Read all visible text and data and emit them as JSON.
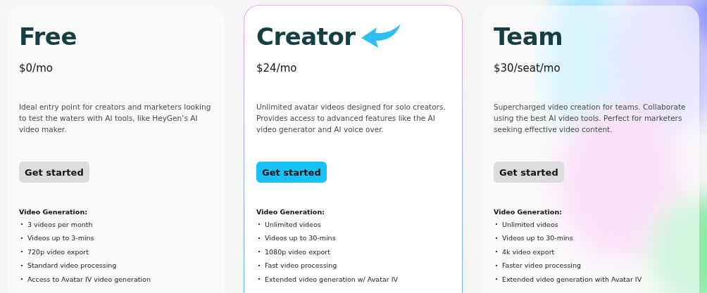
{
  "plans": [
    {
      "name": "Free",
      "price": "$0/mo",
      "featured": false,
      "description": "Ideal entry point for creators and marketers looking to test the waters with AI tools, like HeyGen’s AI video maker.",
      "button": "Get started",
      "section": "Video Generation:",
      "features": [
        "3 videos per month",
        "Videos up to 3-mins",
        "720p video export",
        "Standard video processing",
        "Access to Avatar IV video generation"
      ]
    },
    {
      "name": "Creator",
      "price": "$24/mo",
      "featured": true,
      "description": "Unlimited avatar videos designed for solo creators. Provides access to advanced features like the AI video generator and AI voice over.",
      "button": "Get started",
      "section": "Video Generation:",
      "features": [
        "Unlimited videos",
        "Videos up to 30-mins",
        "1080p video export",
        "Fast video processing",
        "Extended video generation w/ Avatar IV"
      ]
    },
    {
      "name": "Team",
      "price": "$30/seat/mo",
      "featured": false,
      "description": "Supercharged video creation for teams. Collaborate using the best AI video tools. Perfect for marketers seeking effective video content.",
      "button": "Get started",
      "section": "Video Generation:",
      "features": [
        "Unlimited videos",
        "Videos up to 30-mins",
        "4k video export",
        "Faster video processing",
        "Extended video generation with Avatar IV"
      ]
    }
  ]
}
